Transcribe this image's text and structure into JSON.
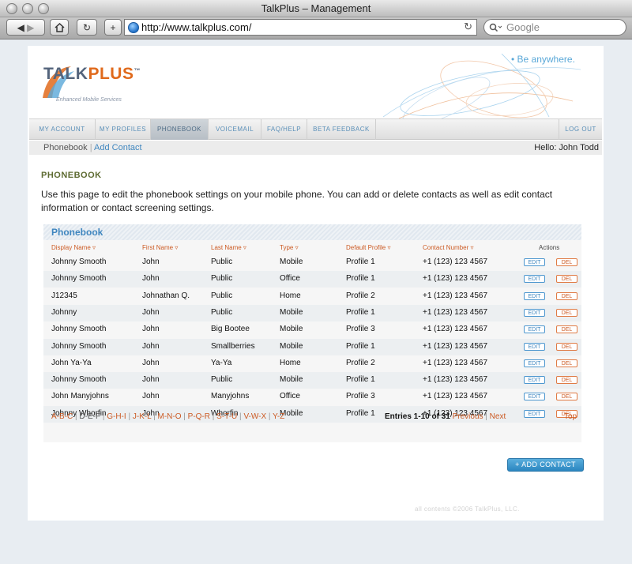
{
  "window": {
    "title": "TalkPlus – Management"
  },
  "browser": {
    "url": "http://www.talkplus.com/",
    "search_placeholder": "Google",
    "add_label": "+"
  },
  "site": {
    "logo": {
      "name_a": "TALK",
      "name_b": "PLUS",
      "tm": "™",
      "tagline": "Enhanced Mobile Services"
    },
    "slogan": "• Be anywhere."
  },
  "nav": {
    "items": [
      "MY ACCOUNT",
      "MY PROFILES",
      "PHONEBOOK",
      "VOICEMAIL",
      "FAQ/HELP",
      "BETA FEEDBACK"
    ],
    "active": "PHONEBOOK",
    "logout": "LOG OUT"
  },
  "subnav": {
    "current": "Phonebook",
    "separator": "|",
    "add_contact": "Add Contact",
    "hello": "Hello: John Todd"
  },
  "section_title": "PHONEBOOK",
  "intro": "Use this page to edit the phonebook settings on your mobile phone. You can add or delete contacts as well as edit contact information or contact screening settings.",
  "phonebook": {
    "title": "Phonebook",
    "columns": [
      "Display Name ▿",
      "First Name ▿",
      "Last Name ▿",
      "Type ▿",
      "Default Profile ▿",
      "Contact Number ▿",
      "Actions"
    ],
    "edit_label": "EDIT",
    "del_label": "DEL",
    "rows": [
      [
        "Johnny Smooth",
        "John",
        "Public",
        "Mobile",
        "Profile 1",
        "+1 (123) 123 4567"
      ],
      [
        "Johnny Smooth",
        "John",
        "Public",
        "Office",
        "Profile 1",
        "+1 (123) 123 4567"
      ],
      [
        "J12345",
        "Johnathan Q.",
        "Public",
        "Home",
        "Profile 2",
        "+1 (123) 123 4567"
      ],
      [
        "Johnny",
        "John",
        "Public",
        "Mobile",
        "Profile 1",
        "+1 (123) 123 4567"
      ],
      [
        "Johnny Smooth",
        "John",
        "Big Bootee",
        "Mobile",
        "Profile 3",
        "+1 (123) 123 4567"
      ],
      [
        "Johnny Smooth",
        "John",
        "Smallberries",
        "Mobile",
        "Profile 1",
        "+1 (123) 123 4567"
      ],
      [
        "John Ya-Ya",
        "John",
        "Ya-Ya",
        "Home",
        "Profile 2",
        "+1 (123) 123 4567"
      ],
      [
        "Johnny Smooth",
        "John",
        "Public",
        "Mobile",
        "Profile 1",
        "+1 (123) 123 4567"
      ],
      [
        "John Manyjohns",
        "John",
        "Manyjohns",
        "Office",
        "Profile 3",
        "+1 (123) 123 4567"
      ],
      [
        "Johnny Whorfin",
        "John",
        "Whorfin",
        "Mobile",
        "Profile 1",
        "+1 (123) 123 4567"
      ]
    ],
    "alpha": [
      {
        "label": "A-B-C",
        "link": true
      },
      {
        "label": "D-E-F",
        "link": false
      },
      {
        "label": "G-H-I",
        "link": true
      },
      {
        "label": "J-K-L",
        "link": true
      },
      {
        "label": "M-N-O",
        "link": true
      },
      {
        "label": "P-Q-R",
        "link": true
      },
      {
        "label": "S-T-U",
        "link": true
      },
      {
        "label": "V-W-X",
        "link": true
      },
      {
        "label": "Y-Z",
        "link": true
      }
    ],
    "entries": "Entries 1-10 of 31",
    "previous": "Previous",
    "next": "Next",
    "top": "Top"
  },
  "add_contact_button": "+ ADD CONTACT",
  "copyright": "all contents ©2006 TalkPlus, LLC."
}
